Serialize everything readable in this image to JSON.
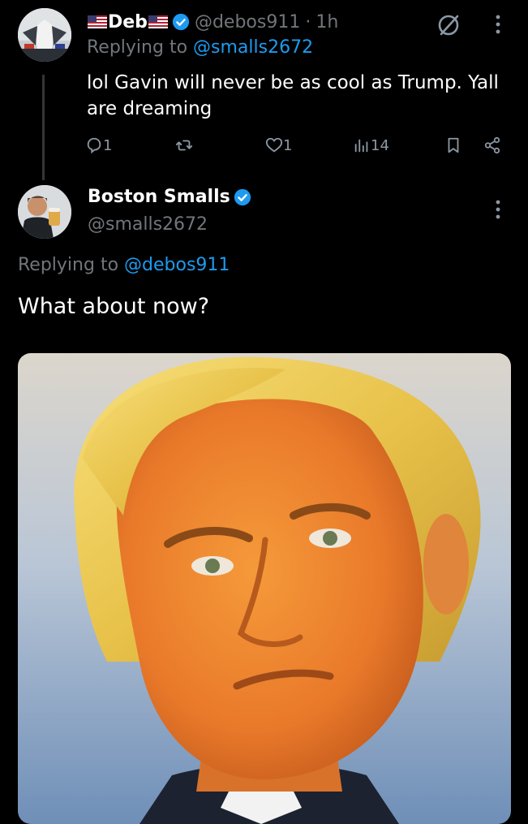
{
  "tweet1": {
    "display_name": "Deb",
    "handle": "@debos911",
    "separator": "·",
    "time": "1h",
    "replying_prefix": "Replying to",
    "replying_to": "@smalls2672",
    "text": "lol Gavin will never be as cool as Trump. Yall are dreaming",
    "actions": {
      "replies": "1",
      "likes": "1",
      "views": "14"
    }
  },
  "tweet2": {
    "display_name": "Boston Smalls",
    "handle": "@smalls2672",
    "replying_prefix": "Replying to",
    "replying_to": "@debos911",
    "text": "What about now?"
  },
  "colors": {
    "background": "#000000",
    "text": "#e7e9ea",
    "muted": "#71767b",
    "link": "#1d9bf0",
    "verified": "#1d9bf0"
  },
  "icons": {
    "verified": "verified-badge-icon",
    "grok": "grok-icon",
    "more": "more-vertical-icon",
    "reply": "reply-icon",
    "retweet": "retweet-icon",
    "like": "heart-icon",
    "views": "views-chart-icon",
    "bookmark": "bookmark-icon",
    "share": "share-icon",
    "flag": "us-flag-icon"
  }
}
